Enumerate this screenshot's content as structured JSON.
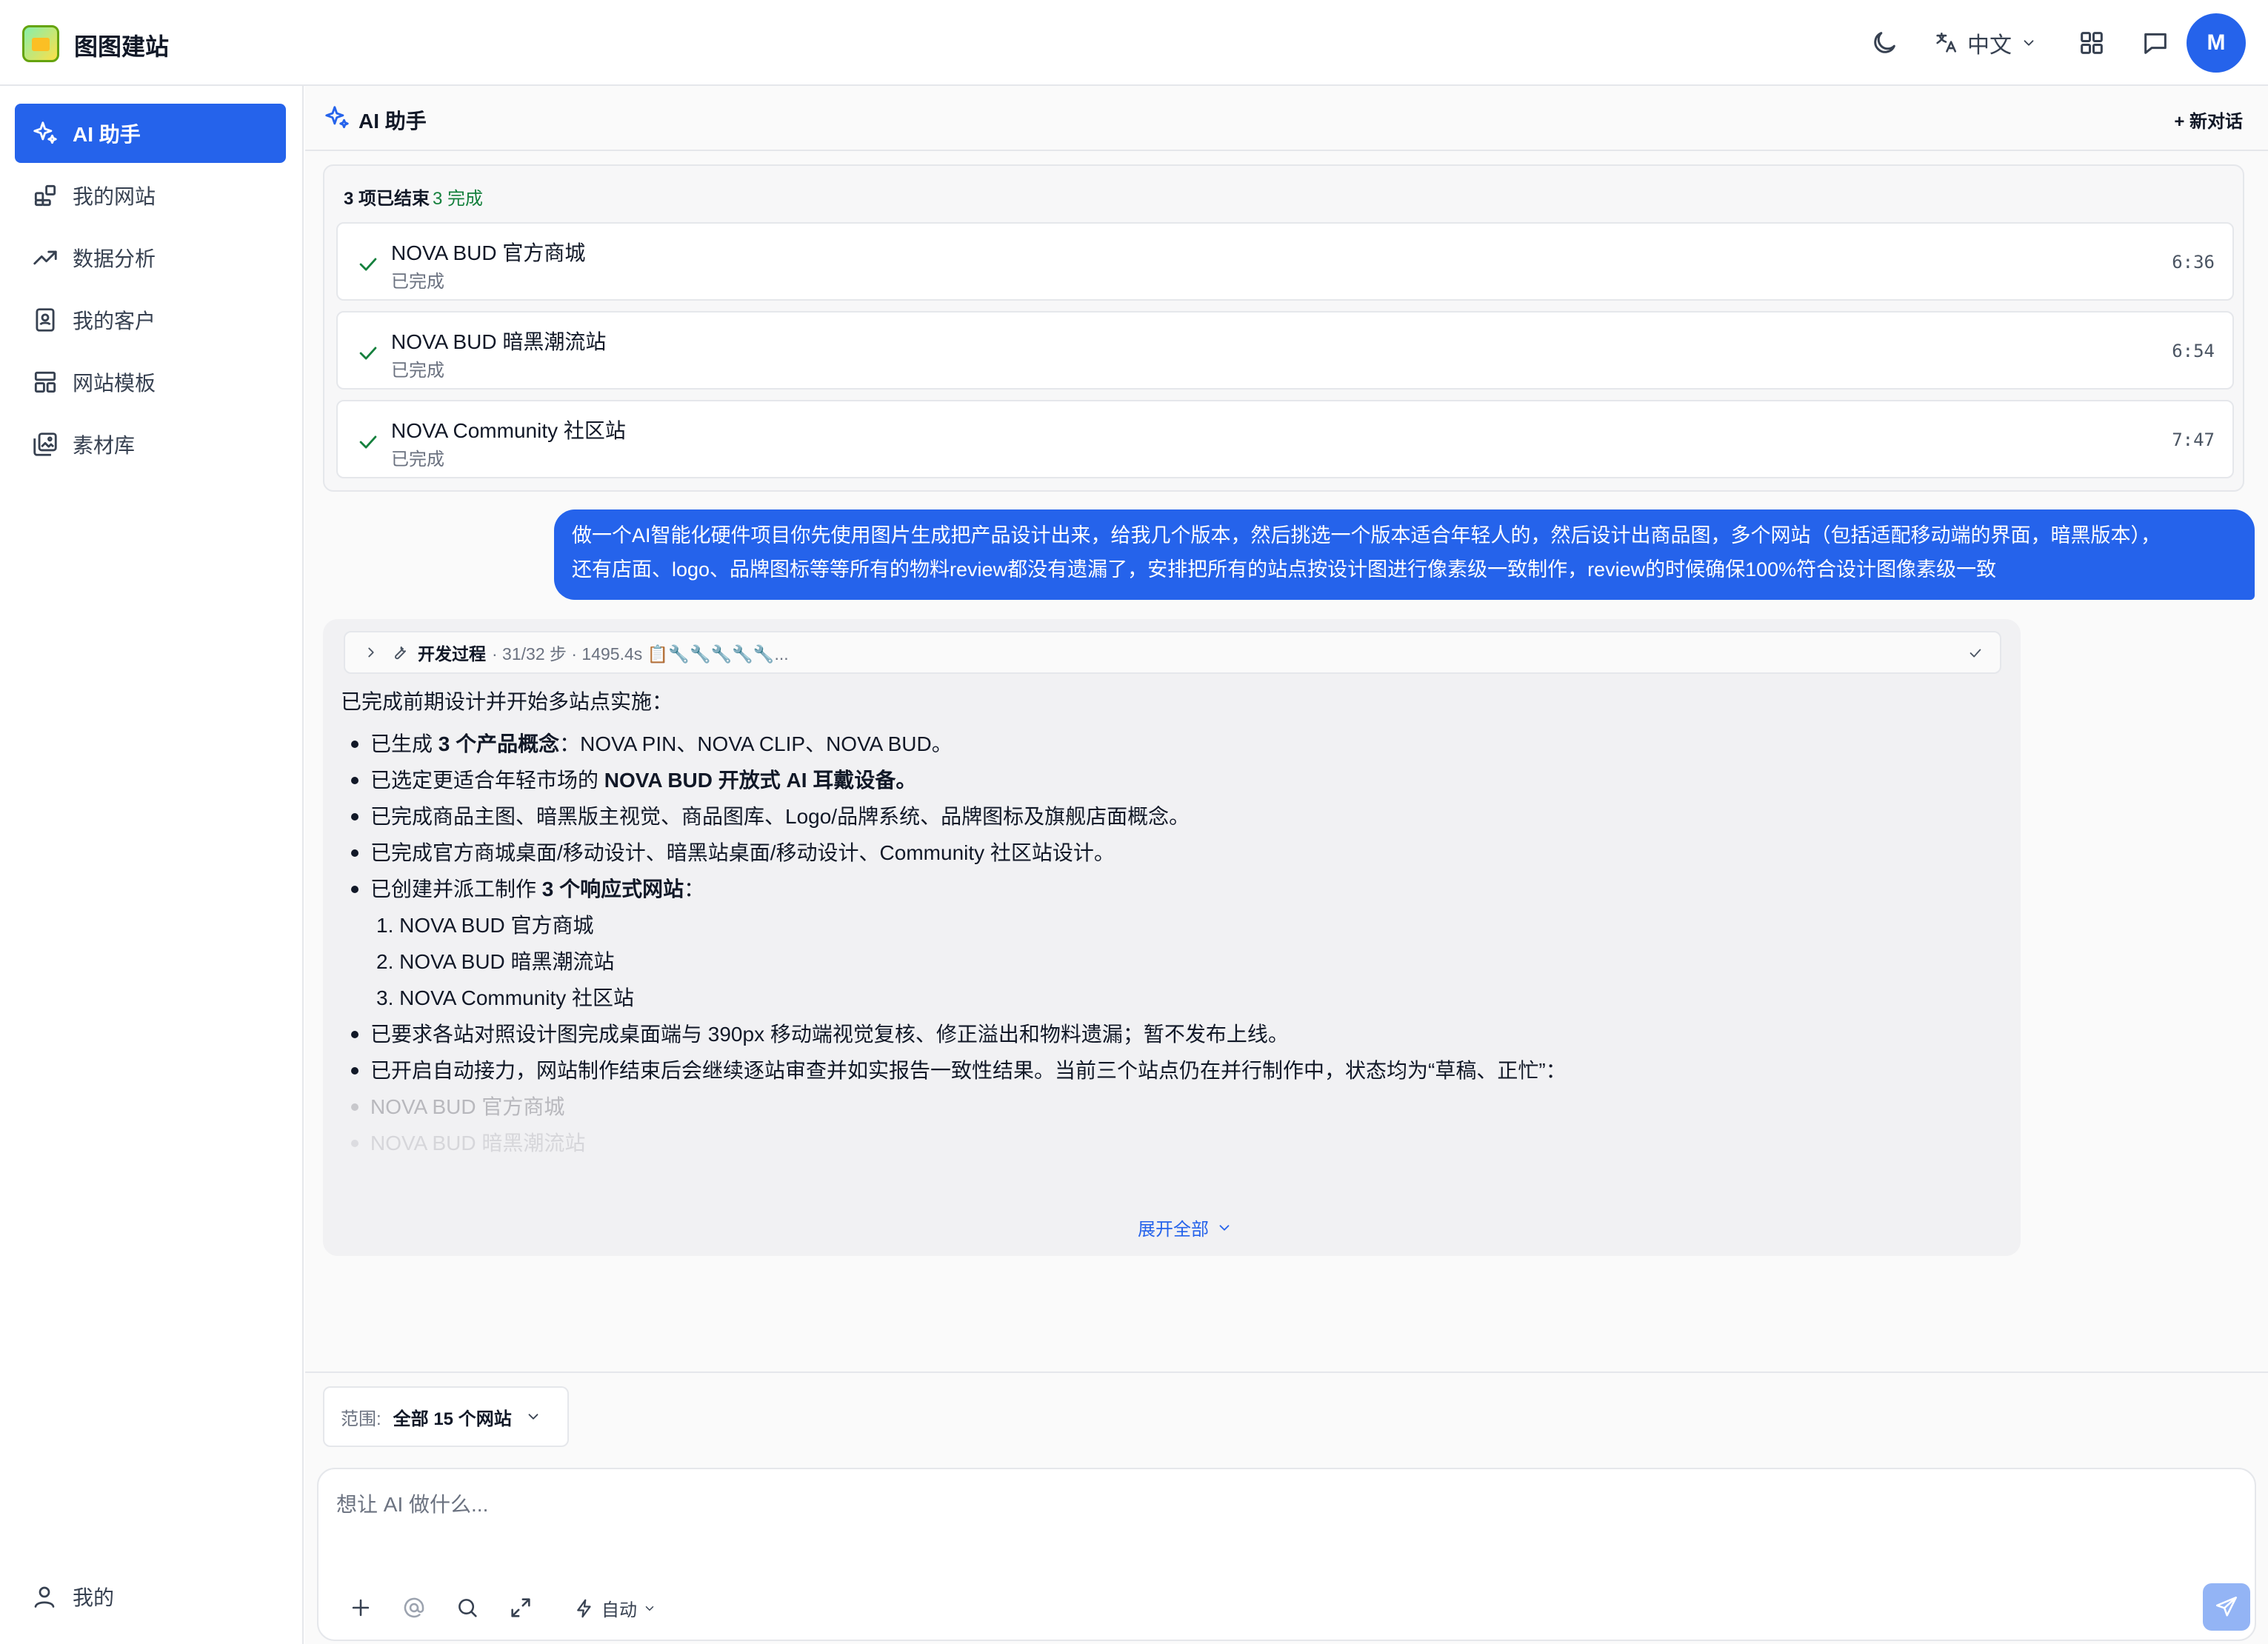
{
  "app": {
    "title": "图图建站",
    "language": "中文",
    "avatar_initial": "M",
    "accent_color": "#2563eb"
  },
  "sidebar": {
    "items": [
      {
        "label": "AI 助手",
        "icon": "sparkles-icon",
        "active": true
      },
      {
        "label": "我的网站",
        "icon": "grid-plus-icon",
        "active": false
      },
      {
        "label": "数据分析",
        "icon": "trending-up-icon",
        "active": false
      },
      {
        "label": "我的客户",
        "icon": "contact-card-icon",
        "active": false
      },
      {
        "label": "网站模板",
        "icon": "layout-template-icon",
        "active": false
      },
      {
        "label": "素材库",
        "icon": "image-library-icon",
        "active": false
      }
    ],
    "bottom": {
      "label": "我的",
      "icon": "user-icon"
    }
  },
  "main": {
    "title": "AI 助手",
    "new_chat_label": "+ 新对话"
  },
  "tasks": {
    "summary": "3 项已结束",
    "done": "3 完成",
    "items": [
      {
        "name": "NOVA BUD 官方商城",
        "status": "已完成",
        "time": "6:36"
      },
      {
        "name": "NOVA BUD 暗黑潮流站",
        "status": "已完成",
        "time": "6:54"
      },
      {
        "name": "NOVA Community 社区站",
        "status": "已完成",
        "time": "7:47"
      }
    ]
  },
  "user_message": {
    "line1": "做一个AI智能化硬件项目你先使用图片生成把产品设计出来，给我几个版本，然后挑选一个版本适合年轻人的，然后设计出商品图，多个网站（包括适配移动端的界面，暗黑版本），",
    "line2": "还有店面、logo、品牌图标等等所有的物料review都没有遗漏了，安排把所有的站点按设计图进行像素级一致制作，review的时候确保100%符合设计图像素级一致"
  },
  "ai_message": {
    "dev_title": "开发过程",
    "dev_meta": "· 31/32 步 · 1495.4s 📋🔧🔧🔧🔧🔧...",
    "intro": "已完成前期设计并开始多站点实施：",
    "b1_pre": "已生成 ",
    "b1_bold": "3 个产品概念",
    "b1_post": "：NOVA PIN、NOVA CLIP、NOVA BUD。",
    "b2_pre": "已选定更适合年轻市场的 ",
    "b2_bold": "NOVA BUD 开放式 AI 耳戴设备。",
    "b3": "已完成商品主图、暗黑版主视觉、商品图库、Logo/品牌系统、品牌图标及旗舰店面概念。",
    "b4": "已完成官方商城桌面/移动设计、暗黑站桌面/移动设计、Community 社区站设计。",
    "b5_pre": "已创建并派工制作 ",
    "b5_bold": "3 个响应式网站",
    "b5_post": "：",
    "sub": [
      "1. NOVA BUD 官方商城",
      "2. NOVA BUD 暗黑潮流站",
      "3. NOVA Community 社区站"
    ],
    "b6": "已要求各站对照设计图完成桌面端与 390px 移动端视觉复核、修正溢出和物料遗漏；暂不发布上线。",
    "b7": "已开启自动接力，网站制作结束后会继续逐站审查并如实报告一致性结果。当前三个站点仍在并行制作中，状态均为“草稿、正忙”：",
    "b8": "NOVA BUD 官方商城",
    "b9": "NOVA BUD 暗黑潮流站",
    "expand_label": "展开全部"
  },
  "composer": {
    "scope_label": "范围:",
    "scope_value": "全部 15 个网站",
    "placeholder": "想让 AI 做什么...",
    "mode_label": "自动"
  }
}
